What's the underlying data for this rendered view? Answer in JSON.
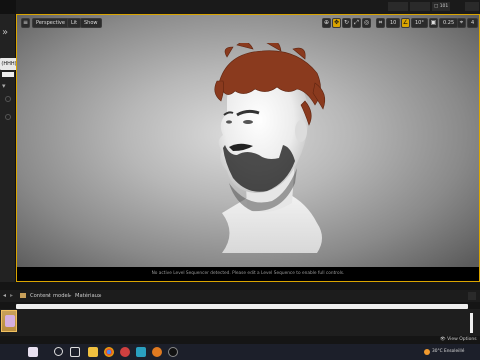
{
  "top_right": {
    "tab_label": "101"
  },
  "left_rail": {
    "badge": "(HHH)"
  },
  "viewport": {
    "perspective_label": "Perspective",
    "lit_label": "Lit",
    "show_label": "Show",
    "snap_value": "10",
    "angle_value": "10°",
    "scale_value": "0.25",
    "cam_speed": "4",
    "bottom_message": "No active Level Sequencer detected. Please edit a Level Sequence to enable full controls."
  },
  "content_browser": {
    "crumbs": [
      "Content",
      "model",
      "Matériaux"
    ],
    "view_options": "View Options"
  },
  "taskbar": {
    "weather": "30°C Ensoleillé"
  },
  "colors": {
    "accent": "#d9a400",
    "hair": "#8a3a1e"
  }
}
